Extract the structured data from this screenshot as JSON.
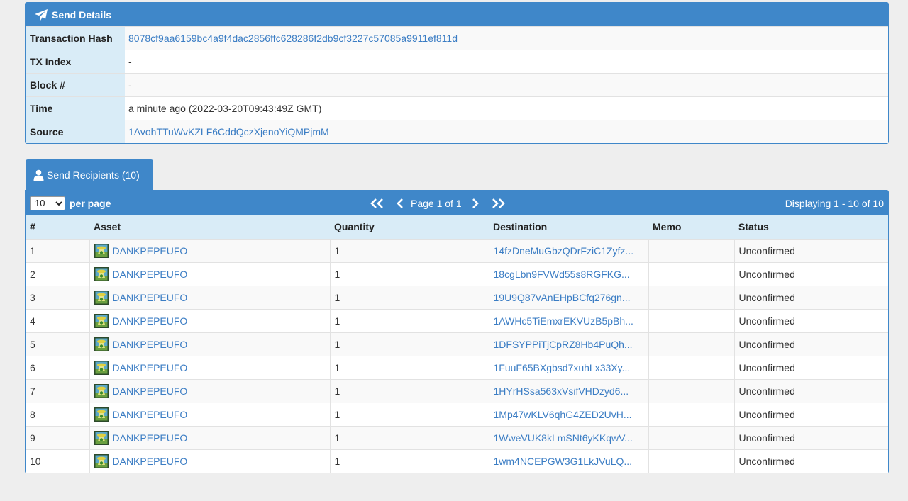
{
  "details": {
    "title": "Send Details",
    "icon": "paper-plane-icon",
    "rows": [
      {
        "label": "Transaction Hash",
        "value": "8078cf9aa6159bc4a9f4dac2856ffc628286f2db9cf3227c57085a9911ef811d",
        "link": true
      },
      {
        "label": "TX Index",
        "value": "-",
        "link": false
      },
      {
        "label": "Block #",
        "value": "-",
        "link": false
      },
      {
        "label": "Time",
        "value": "a minute ago (2022-03-20T09:43:49Z GMT)",
        "link": false
      },
      {
        "label": "Source",
        "value": "1AvohTTuWvKZLF6CddQczXjenoYiQMPjmM",
        "link": true
      }
    ]
  },
  "recipients": {
    "tab_label": "Send Recipients (10)",
    "tab_icon": "user-icon",
    "per_page_value": "10",
    "per_page_label": "per page",
    "page_label": "Page 1 of 1",
    "displaying": "Displaying 1 - 10 of 10",
    "columns": [
      "#",
      "Asset",
      "Quantity",
      "Destination",
      "Memo",
      "Status"
    ],
    "rows": [
      {
        "n": "1",
        "asset": "DANKPEPEUFO",
        "qty": "1",
        "dest": "14fzDneMuGbzQDrFziC1Zyfz...",
        "memo": "",
        "status": "Unconfirmed"
      },
      {
        "n": "2",
        "asset": "DANKPEPEUFO",
        "qty": "1",
        "dest": "18cgLbn9FVWd55s8RGFKG...",
        "memo": "",
        "status": "Unconfirmed"
      },
      {
        "n": "3",
        "asset": "DANKPEPEUFO",
        "qty": "1",
        "dest": "19U9Q87vAnEHpBCfq276gn...",
        "memo": "",
        "status": "Unconfirmed"
      },
      {
        "n": "4",
        "asset": "DANKPEPEUFO",
        "qty": "1",
        "dest": "1AWHc5TiEmxrEKVUzB5pBh...",
        "memo": "",
        "status": "Unconfirmed"
      },
      {
        "n": "5",
        "asset": "DANKPEPEUFO",
        "qty": "1",
        "dest": "1DFSYPPiTjCpRZ8Hb4PuQh...",
        "memo": "",
        "status": "Unconfirmed"
      },
      {
        "n": "6",
        "asset": "DANKPEPEUFO",
        "qty": "1",
        "dest": "1FuuF65BXgbsd7xuhLx33Xy...",
        "memo": "",
        "status": "Unconfirmed"
      },
      {
        "n": "7",
        "asset": "DANKPEPEUFO",
        "qty": "1",
        "dest": "1HYrHSsa563xVsifVHDzyd6...",
        "memo": "",
        "status": "Unconfirmed"
      },
      {
        "n": "8",
        "asset": "DANKPEPEUFO",
        "qty": "1",
        "dest": "1Mp47wKLV6qhG4ZED2UvH...",
        "memo": "",
        "status": "Unconfirmed"
      },
      {
        "n": "9",
        "asset": "DANKPEPEUFO",
        "qty": "1",
        "dest": "1WweVUK8kLmSNt6yKKqwV...",
        "memo": "",
        "status": "Unconfirmed"
      },
      {
        "n": "10",
        "asset": "DANKPEPEUFO",
        "qty": "1",
        "dest": "1wm4NCEPGW3G1LkJVuLQ...",
        "memo": "",
        "status": "Unconfirmed"
      }
    ]
  }
}
